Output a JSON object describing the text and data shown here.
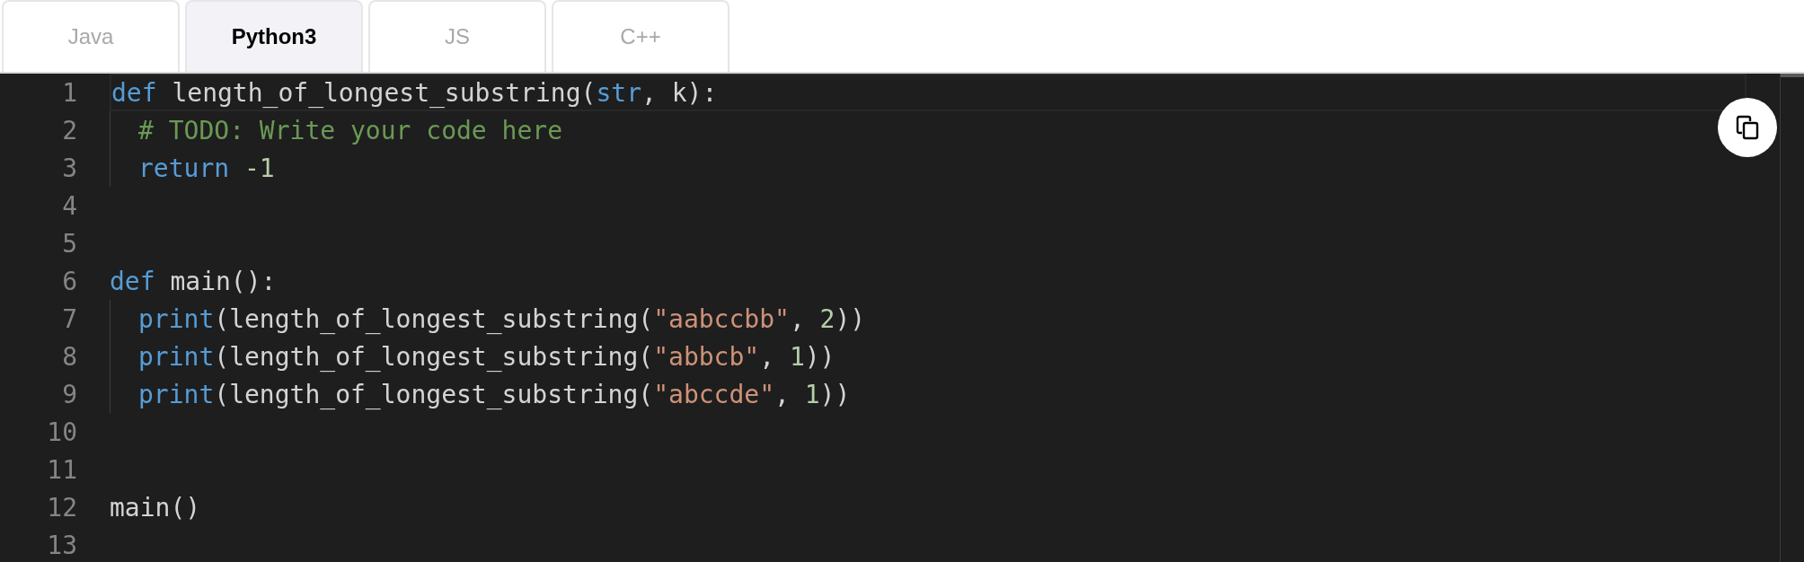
{
  "tabs": [
    {
      "label": "Java",
      "selected": false
    },
    {
      "label": "Python3",
      "selected": true
    },
    {
      "label": "JS",
      "selected": false
    },
    {
      "label": "C++",
      "selected": false
    }
  ],
  "editor": {
    "lines": [
      {
        "number": "1",
        "current": true,
        "tokens": [
          {
            "kind": "keyword",
            "text": "def"
          },
          {
            "kind": "plain",
            "text": " length_of_longest_substring("
          },
          {
            "kind": "keyword",
            "text": "str"
          },
          {
            "kind": "plain",
            "text": ", k):"
          }
        ]
      },
      {
        "number": "2",
        "indent_guide": true,
        "tokens": [
          {
            "kind": "comment",
            "text": "# TODO: Write your code here"
          }
        ]
      },
      {
        "number": "3",
        "indent_guide": true,
        "tokens": [
          {
            "kind": "keyword",
            "text": "return"
          },
          {
            "kind": "number",
            "text": " -1"
          }
        ]
      },
      {
        "number": "4"
      },
      {
        "number": "5"
      },
      {
        "number": "6",
        "tokens": [
          {
            "kind": "keyword",
            "text": "def"
          },
          {
            "kind": "plain",
            "text": " main():"
          }
        ]
      },
      {
        "number": "7",
        "indent_guide": true,
        "tokens": [
          {
            "kind": "keyword",
            "text": "print"
          },
          {
            "kind": "plain",
            "text": "(length_of_longest_substring("
          },
          {
            "kind": "string",
            "text": "\"aabccbb\""
          },
          {
            "kind": "plain",
            "text": ", "
          },
          {
            "kind": "number",
            "text": "2"
          },
          {
            "kind": "plain",
            "text": "))"
          }
        ]
      },
      {
        "number": "8",
        "indent_guide": true,
        "tokens": [
          {
            "kind": "keyword",
            "text": "print"
          },
          {
            "kind": "plain",
            "text": "(length_of_longest_substring("
          },
          {
            "kind": "string",
            "text": "\"abbcb\""
          },
          {
            "kind": "plain",
            "text": ", "
          },
          {
            "kind": "number",
            "text": "1"
          },
          {
            "kind": "plain",
            "text": "))"
          }
        ]
      },
      {
        "number": "9",
        "indent_guide": true,
        "tokens": [
          {
            "kind": "keyword",
            "text": "print"
          },
          {
            "kind": "plain",
            "text": "(length_of_longest_substring("
          },
          {
            "kind": "string",
            "text": "\"abccde\""
          },
          {
            "kind": "plain",
            "text": ", "
          },
          {
            "kind": "number",
            "text": "1"
          },
          {
            "kind": "plain",
            "text": "))"
          }
        ]
      },
      {
        "number": "10"
      },
      {
        "number": "11"
      },
      {
        "number": "12",
        "tokens": [
          {
            "kind": "plain",
            "text": "main()"
          }
        ]
      },
      {
        "number": "13"
      }
    ]
  }
}
